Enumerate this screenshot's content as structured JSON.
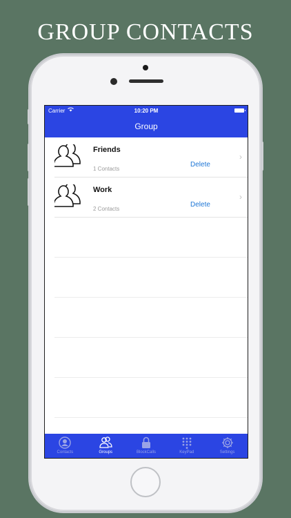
{
  "banner": {
    "title": "GROUP CONTACTS"
  },
  "status_bar": {
    "carrier": "Carrier",
    "time": "10:20 PM"
  },
  "nav": {
    "title": "Group"
  },
  "groups": [
    {
      "name": "Friends",
      "count": "1 Contacts",
      "delete_label": "Delete"
    },
    {
      "name": "Work",
      "count": "2 Contacts",
      "delete_label": "Delete"
    }
  ],
  "tabs": [
    {
      "label": "Contacts",
      "icon": "person-circle-icon"
    },
    {
      "label": "Groups",
      "icon": "people-icon",
      "active": true
    },
    {
      "label": "BlockCalls",
      "icon": "lock-icon"
    },
    {
      "label": "KeyPad",
      "icon": "keypad-icon"
    },
    {
      "label": "Settings",
      "icon": "gear-icon"
    }
  ],
  "colors": {
    "accent": "#2b45e3",
    "link": "#1d76d6",
    "background": "#5a7563"
  }
}
